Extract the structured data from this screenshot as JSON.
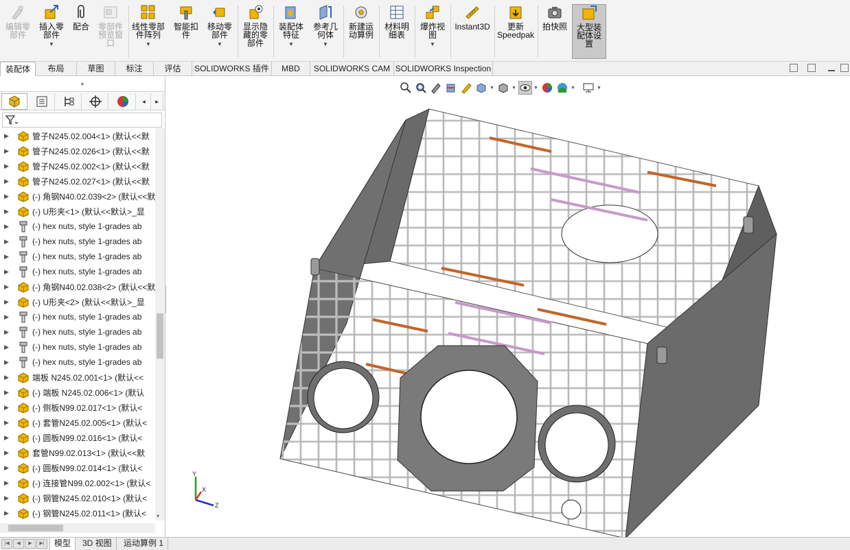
{
  "ribbon": {
    "buttons": [
      {
        "id": "edit-component",
        "label": "编辑零\n部件",
        "icon": "edit-component-icon",
        "disabled": true
      },
      {
        "id": "insert-components",
        "label": "插入零\n部件",
        "icon": "insert-components-icon",
        "dropdown": true
      },
      {
        "id": "mate",
        "label": "配合",
        "icon": "mate-paperclip-icon"
      },
      {
        "id": "component-preview",
        "label": "零部件\n预览窗\n口",
        "icon": "component-preview-icon",
        "disabled": true
      },
      {
        "id": "linear-pattern",
        "label": "线性零部\n件阵列",
        "icon": "linear-pattern-icon",
        "dropdown": true
      },
      {
        "id": "smart-fasteners",
        "label": "智能扣\n件",
        "icon": "smart-fasteners-icon"
      },
      {
        "id": "move-component",
        "label": "移动零\n部件",
        "icon": "move-component-icon",
        "dropdown": true
      },
      {
        "id": "show-hidden",
        "label": "显示隐\n藏的零\n部件",
        "icon": "show-hidden-icon"
      },
      {
        "id": "assembly-features",
        "label": "装配体\n特征",
        "icon": "assembly-features-icon",
        "dropdown": true
      },
      {
        "id": "reference-geometry",
        "label": "参考几\n何体",
        "icon": "reference-geometry-icon",
        "dropdown": true
      },
      {
        "id": "new-motion-study",
        "label": "新建运\n动算例",
        "icon": "motion-study-icon"
      },
      {
        "id": "bill-of-materials",
        "label": "材料明\n细表",
        "icon": "bom-icon"
      },
      {
        "id": "exploded-view",
        "label": "爆炸视\n图",
        "icon": "exploded-view-icon",
        "dropdown": true
      },
      {
        "id": "instant3d",
        "label": "Instant3D",
        "icon": "instant3d-icon"
      },
      {
        "id": "update-speedpak",
        "label": "更新\nSpeedpak",
        "icon": "speedpak-icon"
      },
      {
        "id": "take-snapshot",
        "label": "拍快照",
        "icon": "camera-icon"
      },
      {
        "id": "large-assembly-settings",
        "label": "大型装\n配体设\n置",
        "icon": "large-assembly-icon",
        "active": true
      }
    ]
  },
  "cm_tabs": [
    "装配体",
    "布局",
    "草图",
    "标注",
    "评估",
    "SOLIDWORKS 插件",
    "MBD",
    "SOLIDWORKS CAM",
    "SOLIDWORKS Inspection"
  ],
  "tree": {
    "items": [
      {
        "label": "管子N245.02.004<1> (默认<<默",
        "icon": "part-icon"
      },
      {
        "label": "管子N245.02.026<1> (默认<<默",
        "icon": "part-icon"
      },
      {
        "label": "管子N245.02.002<1> (默认<<默",
        "icon": "part-icon"
      },
      {
        "label": "管子N245.02.027<1> (默认<<默",
        "icon": "part-icon"
      },
      {
        "label": "(-) 角钢N40.02.039<2> (默认<<默",
        "icon": "part-icon"
      },
      {
        "label": "(-) U形夹<1> (默认<<默认>_显",
        "icon": "part-icon"
      },
      {
        "label": "(-) hex nuts, style 1-grades ab",
        "icon": "bolt-icon"
      },
      {
        "label": "(-) hex nuts, style 1-grades ab",
        "icon": "bolt-icon"
      },
      {
        "label": "(-) hex nuts, style 1-grades ab",
        "icon": "bolt-icon"
      },
      {
        "label": "(-) hex nuts, style 1-grades ab",
        "icon": "bolt-icon"
      },
      {
        "label": "(-) 角钢N40.02.038<2> (默认<<默",
        "icon": "part-icon"
      },
      {
        "label": "(-) U形夹<2> (默认<<默认>_显",
        "icon": "part-icon"
      },
      {
        "label": "(-) hex nuts, style 1-grades ab",
        "icon": "bolt-icon"
      },
      {
        "label": "(-) hex nuts, style 1-grades ab",
        "icon": "bolt-icon"
      },
      {
        "label": "(-) hex nuts, style 1-grades ab",
        "icon": "bolt-icon"
      },
      {
        "label": "(-) hex nuts, style 1-grades ab",
        "icon": "bolt-icon"
      },
      {
        "label": "端板 N245.02.001<1> (默认<<",
        "icon": "part-icon"
      },
      {
        "label": "(-) 端板 N245.02.006<1> (默认",
        "icon": "part-icon"
      },
      {
        "label": "(-) 侧板N99.02.017<1> (默认<",
        "icon": "part-icon"
      },
      {
        "label": "(-) 套管N245.02.005<1> (默认<",
        "icon": "part-icon"
      },
      {
        "label": "(-) 圆板N99.02.016<1> (默认<",
        "icon": "part-icon"
      },
      {
        "label": "套管N99.02.013<1> (默认<<默",
        "icon": "part-icon"
      },
      {
        "label": "(-) 圆板N99.02.014<1> (默认<",
        "icon": "part-icon"
      },
      {
        "label": "(-) 连接管N99.02.002<1> (默认<",
        "icon": "part-icon"
      },
      {
        "label": "(-) 钢管N245.02.010<1> (默认<",
        "icon": "part-icon"
      },
      {
        "label": "(-) 钢管N245.02.011<1> (默认<",
        "icon": "part-icon"
      }
    ]
  },
  "bottom_tabs": [
    "模型",
    "3D 视图",
    "运动算例 1"
  ],
  "triad": {
    "x": "X",
    "y": "Y",
    "z": "Z"
  },
  "colors": {
    "accent": "#f1b400",
    "active_button": "#c9c9c9",
    "pipe_orange": "#c0662a",
    "pipe_pink": "#c89ac8",
    "plate_gray": "#6e6e6e"
  }
}
